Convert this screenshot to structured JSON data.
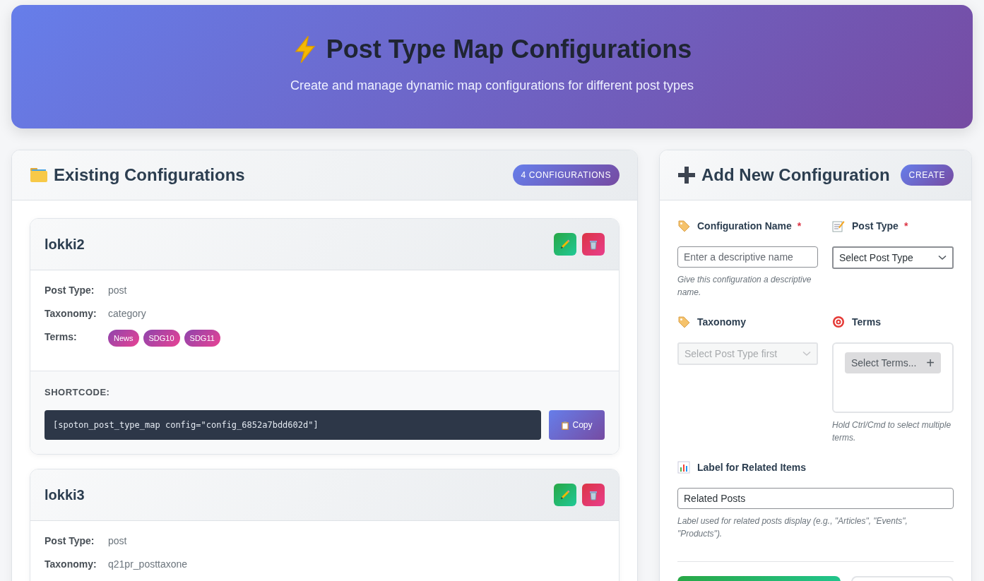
{
  "header": {
    "title": "Post Type Map Configurations",
    "subtitle": "Create and manage dynamic map configurations for different post types"
  },
  "existing": {
    "title": "Existing Configurations",
    "count_badge": "4 CONFIGURATIONS",
    "configurations": [
      {
        "name": "lokki2",
        "fields": [
          {
            "label": "Post Type:",
            "value": "post"
          },
          {
            "label": "Taxonomy:",
            "value": "category"
          }
        ],
        "terms_label": "Terms:",
        "terms": [
          "News",
          "SDG10",
          "SDG11"
        ],
        "shortcode_label": "SHORTCODE:",
        "shortcode": "[spoton_post_type_map config=\"config_6852a7bdd602d\"]",
        "copy_button": "Copy"
      },
      {
        "name": "lokki3",
        "fields": [
          {
            "label": "Post Type:",
            "value": "post"
          },
          {
            "label": "Taxonomy:",
            "value": "q21pr_posttaxone"
          }
        ]
      }
    ]
  },
  "add_new": {
    "title": "Add New Configuration",
    "badge": "CREATE",
    "config_name": {
      "label": "Configuration Name",
      "required": true,
      "required_mark": "*",
      "placeholder": "Enter a descriptive name",
      "help": "Give this configuration a descriptive name."
    },
    "post_type": {
      "label": "Post Type",
      "required": true,
      "required_mark": "*",
      "value": "Select Post Type"
    },
    "taxonomy": {
      "label": "Taxonomy",
      "placeholder": "Select Post Type first",
      "disabled": true
    },
    "terms": {
      "label": "Terms",
      "button": "Select Terms...",
      "button_icon": "+",
      "help": "Hold Ctrl/Cmd to select multiple terms."
    },
    "related_label": {
      "label": "Label for Related Items",
      "value": "Related Posts",
      "help": "Label used for related posts display (e.g., \"Articles\", \"Events\", \"Products\")."
    }
  }
}
